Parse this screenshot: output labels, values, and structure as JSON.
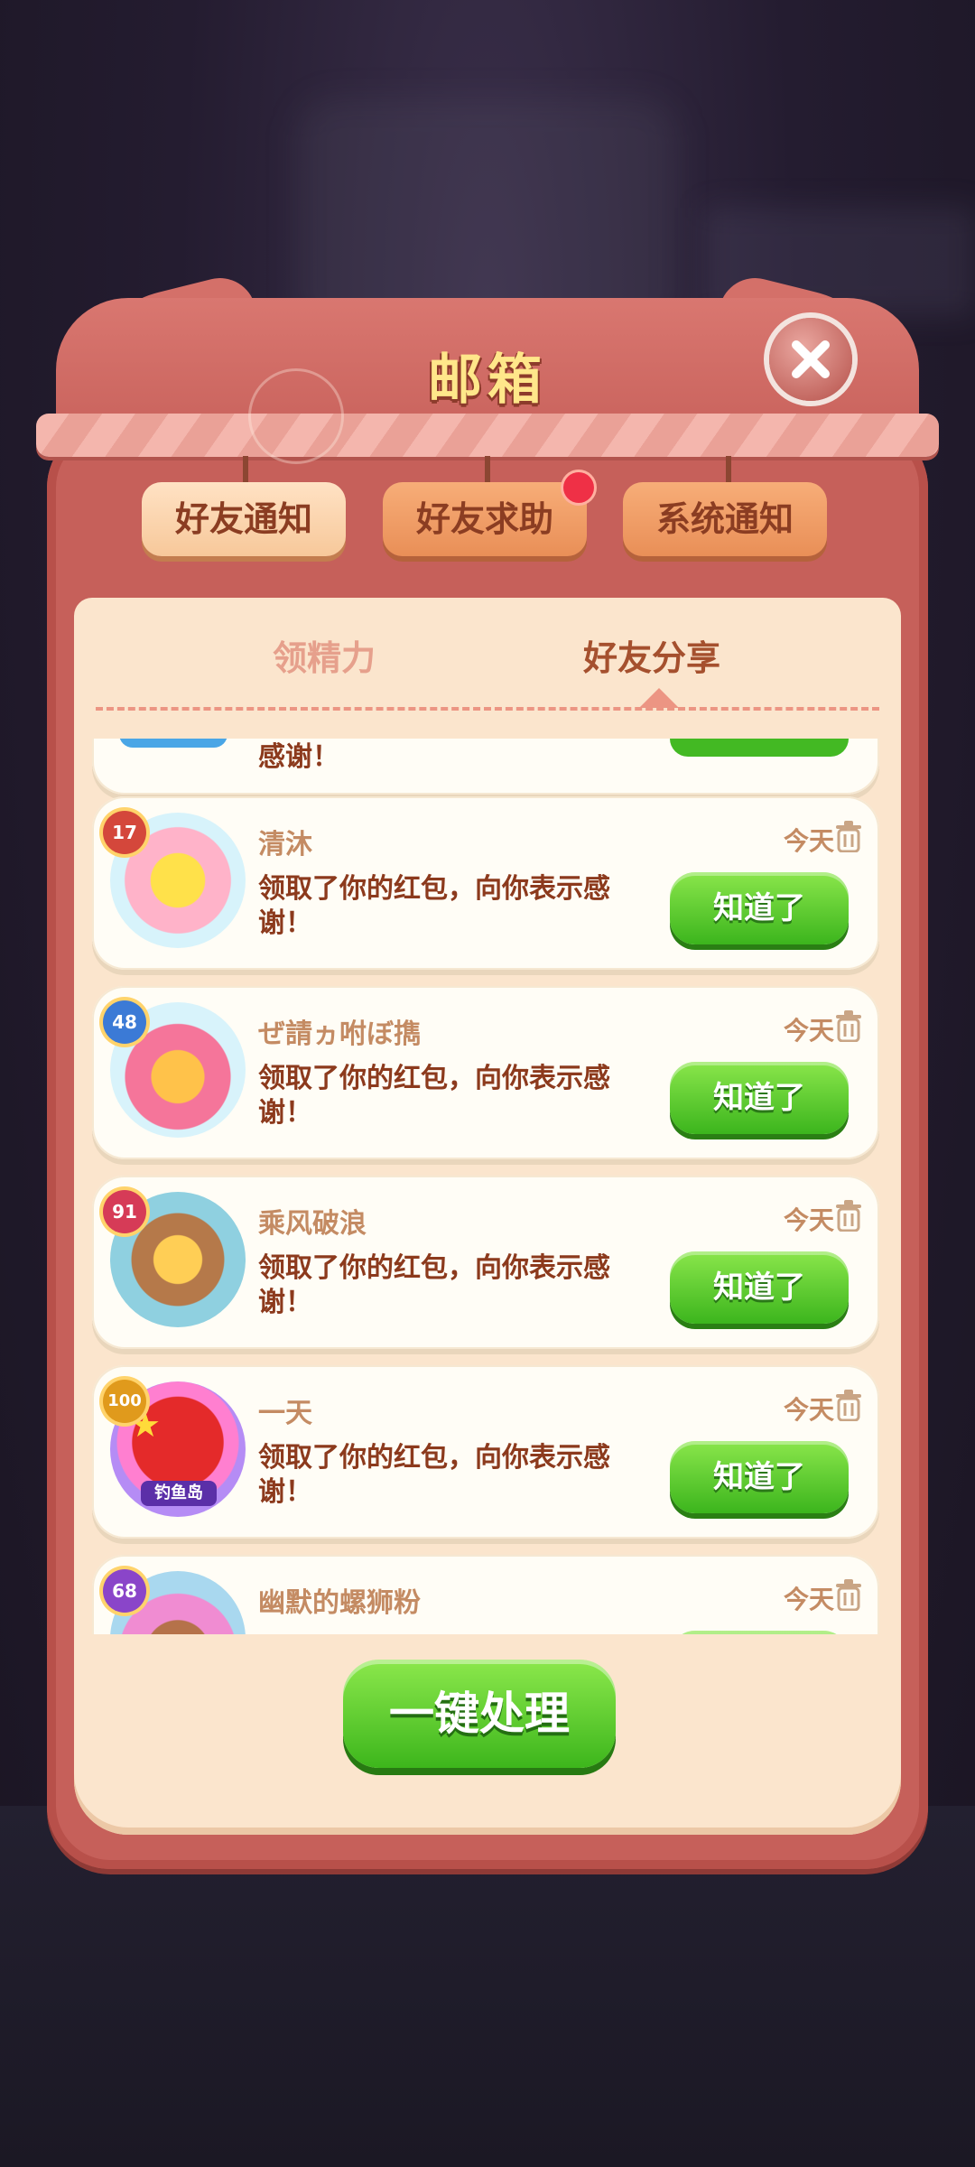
{
  "mailbox": {
    "title": "邮箱",
    "top_tabs": [
      {
        "label": "好友通知",
        "state": "selected"
      },
      {
        "label": "好友求助",
        "state": "unselected",
        "badge": "red-dot"
      },
      {
        "label": "系统通知",
        "state": "unselected"
      }
    ],
    "sub_tabs": [
      {
        "label": "领精力",
        "state": "unselected"
      },
      {
        "label": "好友分享",
        "state": "selected"
      }
    ],
    "partial_top_item": {
      "message_tail": "感谢！"
    },
    "items": [
      {
        "name": "清沐",
        "level": "17",
        "time": "今天",
        "message": "领取了你的红包，向你表示感谢！",
        "button": "知道了",
        "avatar_icon": "chick-avatar-icon"
      },
      {
        "name": "ぜ請ヵ咐ぼ擕",
        "level": "48",
        "time": "今天",
        "message": "领取了你的红包，向你表示感谢！",
        "button": "知道了",
        "avatar_icon": "crab-chick-avatar-icon"
      },
      {
        "name": "乘风破浪",
        "level": "91",
        "time": "今天",
        "message": "领取了你的红包，向你表示感谢！",
        "button": "知道了",
        "avatar_icon": "otter-avatar-icon"
      },
      {
        "name": "一天",
        "level": "100",
        "time": "今天",
        "message": "领取了你的红包，向你表示感谢！",
        "button": "知道了",
        "avatar_icon": "china-flag-avatar-icon",
        "avatar_caption": "钓鱼岛"
      },
      {
        "name": "幽默的螺狮粉",
        "level": "68",
        "time": "今天",
        "message": "",
        "button": "",
        "avatar_icon": "party-avatar-icon"
      }
    ],
    "action_button": "一键处理",
    "colors": {
      "panel": "#fbe5cd",
      "frame": "#c6605a",
      "green_button": "#4cc327",
      "badge_red": "#ef3046"
    }
  }
}
